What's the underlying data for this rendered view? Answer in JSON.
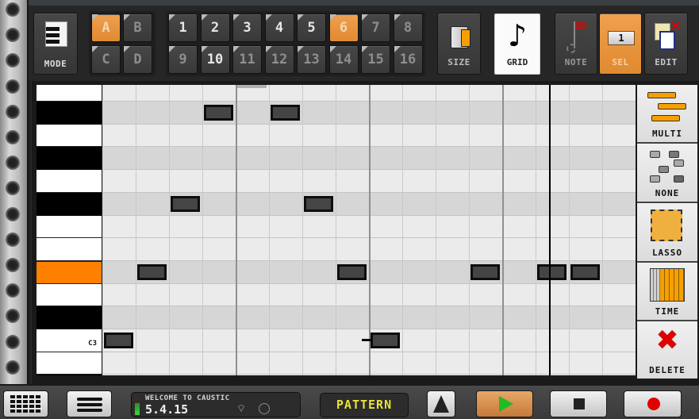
{
  "app": "Caustic",
  "toolbar": {
    "mode_label": "MODE",
    "banks": [
      {
        "label": "A",
        "active": true
      },
      {
        "label": "B",
        "active": false
      },
      {
        "label": "C",
        "active": false
      },
      {
        "label": "D",
        "active": false
      }
    ],
    "patterns": [
      {
        "label": "1"
      },
      {
        "label": "2"
      },
      {
        "label": "3"
      },
      {
        "label": "4"
      },
      {
        "label": "5"
      },
      {
        "label": "6",
        "active": true
      },
      {
        "label": "7"
      },
      {
        "label": "8"
      },
      {
        "label": "9"
      },
      {
        "label": "10"
      },
      {
        "label": "11"
      },
      {
        "label": "12"
      },
      {
        "label": "13"
      },
      {
        "label": "14"
      },
      {
        "label": "15"
      },
      {
        "label": "16"
      }
    ],
    "size_label": "SIZE",
    "grid_label": "GRID",
    "note_label": "NOTE",
    "sel_label": "SEL",
    "sel_value": "1",
    "edit_label": "EDIT"
  },
  "piano": {
    "keys": [
      {
        "note": "B3",
        "color": "white"
      },
      {
        "note": "A#3",
        "color": "black"
      },
      {
        "note": "A3",
        "color": "white"
      },
      {
        "note": "G#3",
        "color": "black"
      },
      {
        "note": "G3",
        "color": "white"
      },
      {
        "note": "F#3",
        "color": "black"
      },
      {
        "note": "F3",
        "color": "white"
      },
      {
        "note": "E3",
        "color": "white"
      },
      {
        "note": "D#3",
        "color": "black",
        "highlighted": true
      },
      {
        "note": "D3",
        "color": "white"
      },
      {
        "note": "C#3",
        "color": "black"
      },
      {
        "note": "C3",
        "color": "white",
        "label": "C3"
      },
      {
        "note": "B2",
        "color": "white"
      }
    ]
  },
  "sequencer": {
    "steps": 16,
    "bar_every": 4,
    "playhead_step": 13.4,
    "notes": [
      {
        "pitch": "A#3",
        "step": 3
      },
      {
        "pitch": "A#3",
        "step": 5
      },
      {
        "pitch": "F#3",
        "step": 2
      },
      {
        "pitch": "F#3",
        "step": 6
      },
      {
        "pitch": "D#3",
        "step": 1
      },
      {
        "pitch": "D#3",
        "step": 7
      },
      {
        "pitch": "D#3",
        "step": 11
      },
      {
        "pitch": "D#3",
        "step": 13
      },
      {
        "pitch": "D#3",
        "step": 14
      },
      {
        "pitch": "C3",
        "step": 0
      },
      {
        "pitch": "C3",
        "step": 8,
        "tied": true
      }
    ]
  },
  "select_modes": [
    {
      "label": "MULTI",
      "icon": "multi-select-icon"
    },
    {
      "label": "NONE",
      "icon": "select-none-icon"
    },
    {
      "label": "LASSO",
      "icon": "lasso-icon"
    },
    {
      "label": "TIME",
      "icon": "time-select-icon"
    },
    {
      "label": "DELETE",
      "icon": "delete-x-icon"
    }
  ],
  "status": {
    "message": "WELCOME TO CAUSTIC",
    "version": "5.4.15",
    "mode_display": "PATTERN"
  },
  "colors": {
    "accent": "#e88a2e",
    "highlight_key": "#ff8000",
    "pattern_text": "#e8e23a",
    "play_green": "#22bb22",
    "record_red": "#e00000"
  }
}
